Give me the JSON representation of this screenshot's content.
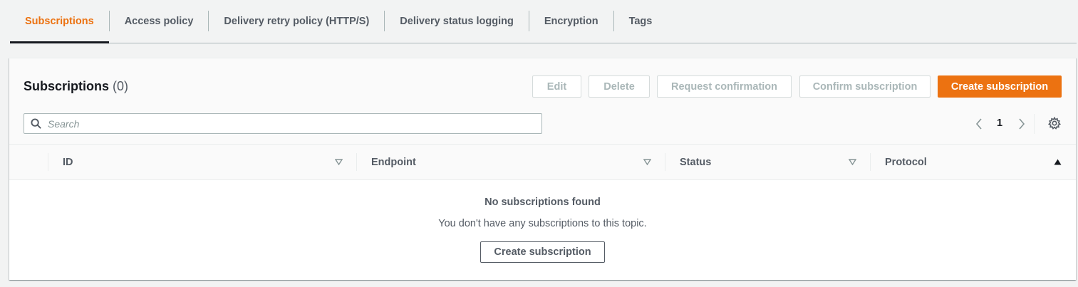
{
  "tabs": [
    {
      "label": "Subscriptions",
      "active": true
    },
    {
      "label": "Access policy",
      "active": false
    },
    {
      "label": "Delivery retry policy (HTTP/S)",
      "active": false
    },
    {
      "label": "Delivery status logging",
      "active": false
    },
    {
      "label": "Encryption",
      "active": false
    },
    {
      "label": "Tags",
      "active": false
    }
  ],
  "panel": {
    "title": "Subscriptions",
    "count": "(0)",
    "buttons": {
      "edit": "Edit",
      "delete": "Delete",
      "request_confirmation": "Request confirmation",
      "confirm_subscription": "Confirm subscription",
      "create_subscription": "Create subscription"
    },
    "search": {
      "placeholder": "Search",
      "value": ""
    },
    "pagination": {
      "current_page": "1"
    }
  },
  "table": {
    "columns": [
      {
        "label": "ID",
        "sort": "none"
      },
      {
        "label": "Endpoint",
        "sort": "none"
      },
      {
        "label": "Status",
        "sort": "none"
      },
      {
        "label": "Protocol",
        "sort": "ascending"
      }
    ]
  },
  "empty_state": {
    "title": "No subscriptions found",
    "description": "You don't have any subscriptions to this topic.",
    "button": "Create subscription"
  },
  "colors": {
    "accent": "#ec7211",
    "text_primary": "#16191f",
    "text_secondary": "#545b64",
    "disabled": "#aab7b8",
    "background": "#f2f3f3"
  },
  "icons": [
    "search-icon",
    "chevron-left-icon",
    "chevron-right-icon",
    "settings-gear-icon",
    "sort-caret-down-icon",
    "sort-caret-up-icon"
  ]
}
